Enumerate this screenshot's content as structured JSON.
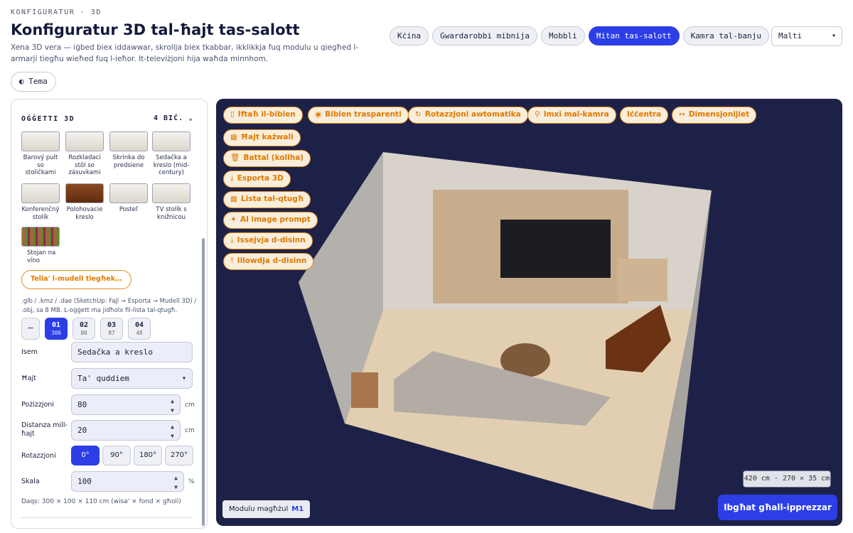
{
  "header": {
    "breadcrumb": "KONFIGURATUR · 3D",
    "title": "Konfiguratur 3D tal-ħajt tas-salott",
    "subtitle": "Xena 3D vera — iġbed biex iddawwar, skrollja biex tkabbar, ikklikkja fuq modulu u qiegħed l-armarji tiegħu wieħed fuq l-ieħor. It-televiżjoni hija waħda minnhom.",
    "tabs": [
      {
        "label": "Kċina",
        "active": false
      },
      {
        "label": "Gwardarobbi mibnija",
        "active": false
      },
      {
        "label": "Mobbli",
        "active": false
      },
      {
        "label": "Ħitan tas-salott",
        "active": true
      },
      {
        "label": "Kamra tal-banju",
        "active": false
      }
    ],
    "language": "Malti",
    "theme_label": "Tema"
  },
  "sidebar": {
    "section_title": "OĠĠETTI 3D",
    "section_count": "4 BIĊ.",
    "objects": [
      {
        "label": "Barový pult so stoličkami"
      },
      {
        "label": "Rozkladací stôl so zásuvkami"
      },
      {
        "label": "Skrinka do predsiene"
      },
      {
        "label": "Sedačka a kreslo (mid-century)"
      },
      {
        "label": "Konferenčný stolík"
      },
      {
        "label": "Polohovacie kreslo"
      },
      {
        "label": "Posteľ"
      },
      {
        "label": "TV stolík s knižnicou"
      },
      {
        "label": "Stojan na víno"
      }
    ],
    "upload_label": "Tella' l-mudell tiegħek…",
    "upload_hint": ".glb / .kmz / .dae (SketchUp: Fajl → Esporta → Mudell 3D) / .obj, sa 8 MB. L-oġġett ma jidħolx fil-lista tal-qtugħ.",
    "modules": [
      {
        "num": "—",
        "sub": ""
      },
      {
        "num": "01",
        "sub": "300",
        "active": true
      },
      {
        "num": "02",
        "sub": "80"
      },
      {
        "num": "03",
        "sub": "87"
      },
      {
        "num": "04",
        "sub": "48"
      }
    ],
    "fields": {
      "name_label": "Isem",
      "name_value": "Sedačka a kreslo",
      "wall_label": "Ħajt",
      "wall_value": "Ta' quddiem",
      "position_label": "Pożizzjoni",
      "position_value": "80",
      "position_unit": "cm",
      "distance_label": "Distanza mill-ħajt",
      "distance_value": "20",
      "distance_unit": "cm",
      "rotation_label": "Rotazzjoni",
      "rotations": [
        "0°",
        "90°",
        "180°",
        "270°"
      ],
      "scale_label": "Skala",
      "scale_value": "100",
      "scale_unit": "%"
    },
    "dims_note": "Daqs: 300 × 100 × 110 cm (wisa' × fond × għoli)"
  },
  "viewer": {
    "toolbar_row1": [
      {
        "icon": "▯",
        "label": "Iftaħ il-bibien"
      },
      {
        "icon": "◉",
        "label": "Bibien trasparenti"
      },
      {
        "icon": "↻",
        "label": "Rotazzjoni awtomatika"
      },
      {
        "icon": "⚲",
        "label": "Imxi mal-kamra"
      },
      {
        "icon": "",
        "label": "Iċċentra"
      },
      {
        "icon": "↔",
        "label": "Dimensjonijiet"
      }
    ],
    "toolbar_col": [
      {
        "icon": "▦",
        "label": "Ħajt każwali"
      },
      {
        "icon": "🗑",
        "label": "Battal (kollha)"
      },
      {
        "icon": "⤓",
        "label": "Esporta 3D"
      },
      {
        "icon": "▦",
        "label": "Lista tal-qtugħ"
      },
      {
        "icon": "✦",
        "label": "AI image prompt"
      },
      {
        "icon": "⤓",
        "label": "Issejvja d-disinn"
      },
      {
        "icon": "⤒",
        "label": "Illowdja d-disinn"
      }
    ],
    "room_dims": "420 cm · 270 × 35 cm",
    "selected_module_label": "Modulu magħżul",
    "selected_module": "M1",
    "save_label": "Ibgħat għall-ipprezzar"
  }
}
